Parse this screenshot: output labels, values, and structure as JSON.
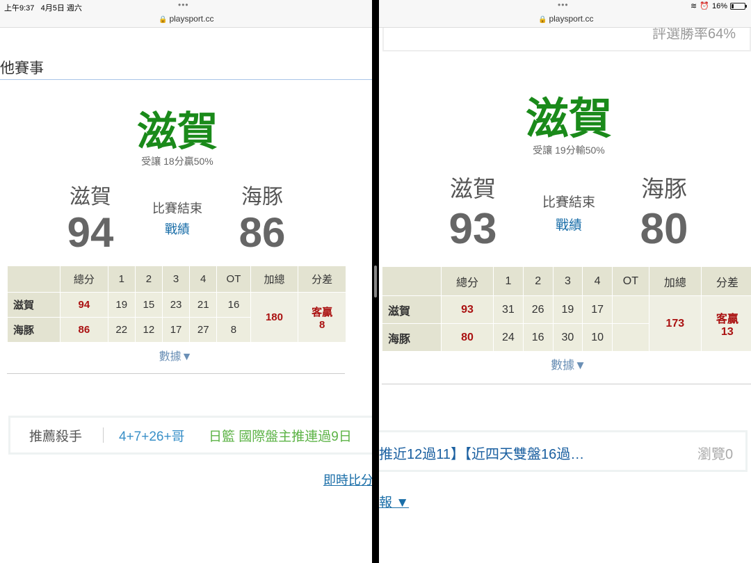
{
  "status": {
    "time": "上午9:37",
    "date": "4月5日 週六",
    "battery": "16%",
    "battery_level": 0.16
  },
  "left": {
    "dots": "•••",
    "url": "playsport.cc",
    "section_heading": "他賽事",
    "winner": "滋賀",
    "handicap": "受讓 18分贏50%",
    "home_name": "滋賀",
    "home_score": "94",
    "away_name": "海豚",
    "away_score": "86",
    "game_status": "比賽結束",
    "record_link": "戰績",
    "table": {
      "headers": [
        "總分",
        "1",
        "2",
        "3",
        "4",
        "OT",
        "加總",
        "分差"
      ],
      "rows": [
        {
          "team": "滋賀",
          "total": "94",
          "q": [
            "19",
            "15",
            "23",
            "21",
            "16"
          ]
        },
        {
          "team": "海豚",
          "total": "86",
          "q": [
            "22",
            "12",
            "17",
            "27",
            "8"
          ]
        }
      ],
      "sum": "180",
      "diff_label": "客贏",
      "diff_value": "8"
    },
    "more_data": "數據▼",
    "rec_label": "推薦殺手",
    "rec_code": "4+7+26+哥",
    "rec_title": "日籃 國際盤主推連過9日",
    "live_link": "即時比分"
  },
  "right": {
    "dots": "•••",
    "url": "playsport.cc",
    "top_card_text": "評選勝率64%",
    "winner": "滋賀",
    "handicap": "受讓 19分輸50%",
    "home_name": "滋賀",
    "home_score": "93",
    "away_name": "海豚",
    "away_score": "80",
    "game_status": "比賽結束",
    "record_link": "戰績",
    "table": {
      "headers": [
        "總分",
        "1",
        "2",
        "3",
        "4",
        "OT",
        "加總",
        "分差"
      ],
      "rows": [
        {
          "team": "滋賀",
          "total": "93",
          "q": [
            "31",
            "26",
            "19",
            "17",
            ""
          ]
        },
        {
          "team": "海豚",
          "total": "80",
          "q": [
            "24",
            "16",
            "30",
            "10",
            ""
          ]
        }
      ],
      "sum": "173",
      "diff_label": "客贏",
      "diff_value": "13"
    },
    "more_data": "數據▼",
    "article_title": "推近12過11】【近四天雙盤16過…",
    "views": "瀏覽0",
    "bottom_link": "報 ▼"
  }
}
